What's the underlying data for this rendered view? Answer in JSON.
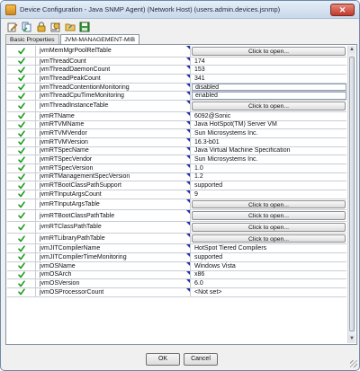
{
  "window": {
    "title": "Device Configuration - Java SNMP Agent) (Network Host) (users.admin.devices.jsnmp)",
    "close_glyph": "✕"
  },
  "tabs": [
    {
      "label": "Basic Properties"
    },
    {
      "label": "JVM-MANAGEMENT-MIB"
    }
  ],
  "rows": [
    {
      "name": "jvmMemMgrPoolRelTable",
      "value": "Click to open...",
      "kind": "button"
    },
    {
      "name": "jvmThreadCount",
      "value": "174",
      "kind": "text"
    },
    {
      "name": "jvmThreadDaemonCount",
      "value": "153",
      "kind": "text"
    },
    {
      "name": "jvmThreadPeakCount",
      "value": "341",
      "kind": "text"
    },
    {
      "name": "jvmThreadContentionMonitoring",
      "value": "disabled",
      "kind": "input"
    },
    {
      "name": "jvmThreadCpuTimeMonitoring",
      "value": "enabled",
      "kind": "input"
    },
    {
      "name": "jvmThreadInstanceTable",
      "value": "Click to open...",
      "kind": "button"
    },
    {
      "name": "jvmRTName",
      "value": "6092@Sonic",
      "kind": "text"
    },
    {
      "name": "jvmRTVMName",
      "value": "Java HotSpot(TM) Server VM",
      "kind": "text"
    },
    {
      "name": "jvmRTVMVendor",
      "value": "Sun Microsystems Inc.",
      "kind": "text"
    },
    {
      "name": "jvmRTVMVersion",
      "value": "16.3-b01",
      "kind": "text"
    },
    {
      "name": "jvmRTSpecName",
      "value": "Java Virtual Machine Specification",
      "kind": "text"
    },
    {
      "name": "jvmRTSpecVendor",
      "value": "Sun Microsystems Inc.",
      "kind": "text"
    },
    {
      "name": "jvmRTSpecVersion",
      "value": "1.0",
      "kind": "text"
    },
    {
      "name": "jvmRTManagementSpecVersion",
      "value": "1.2",
      "kind": "text"
    },
    {
      "name": "jvmRTBootClassPathSupport",
      "value": "supported",
      "kind": "text"
    },
    {
      "name": "jvmRTInputArgsCount",
      "value": "9",
      "kind": "text"
    },
    {
      "name": "jvmRTInputArgsTable",
      "value": "Click to open...",
      "kind": "button"
    },
    {
      "name": "jvmRTBootClassPathTable",
      "value": "Click to open...",
      "kind": "button"
    },
    {
      "name": "jvmRTClassPathTable",
      "value": "Click to open...",
      "kind": "button"
    },
    {
      "name": "jvmRTLibraryPathTable",
      "value": "Click to open...",
      "kind": "button"
    },
    {
      "name": "jvmJITCompilerName",
      "value": "HotSpot Tiered Compilers",
      "kind": "text"
    },
    {
      "name": "jvmJITCompilerTimeMonitoring",
      "value": "supported",
      "kind": "text"
    },
    {
      "name": "jvmOSName",
      "value": "Windows Vista",
      "kind": "text"
    },
    {
      "name": "jvmOSArch",
      "value": "x86",
      "kind": "text"
    },
    {
      "name": "jvmOSVersion",
      "value": "6.0",
      "kind": "text"
    },
    {
      "name": "jvmOSProcessorCount",
      "value": "<Not set>",
      "kind": "text"
    }
  ],
  "toolbar": {
    "icons": [
      "edit-icon",
      "copy-icon",
      "lock-icon",
      "properties-icon",
      "folder-icon",
      "save-icon"
    ]
  },
  "footer": {
    "ok_label": "OK",
    "cancel_label": "Cancel"
  },
  "colors": {
    "check": "#1a9c1a",
    "accent_triangle": "#1e2fa8"
  }
}
